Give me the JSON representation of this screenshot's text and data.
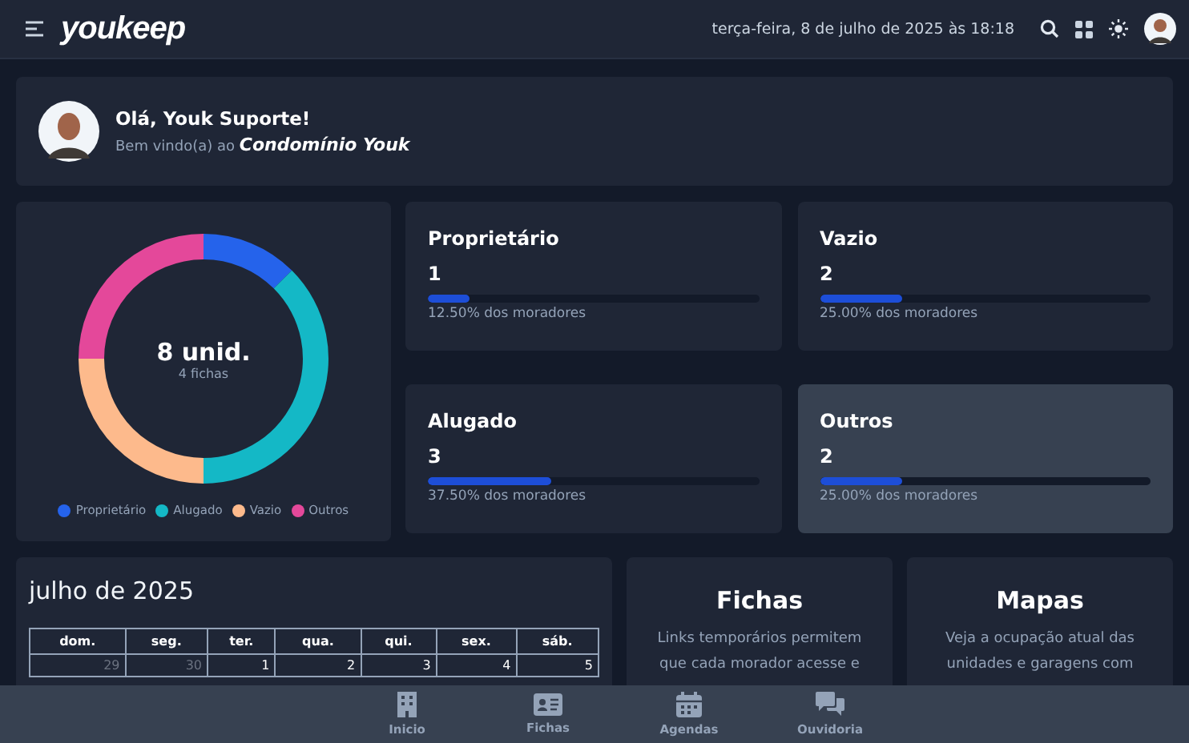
{
  "topbar": {
    "logo": "youkeep",
    "datetime": "terça-feira, 8 de julho de 2025 às 18:18"
  },
  "welcome": {
    "greeting": "Olá, Youk Suporte!",
    "subtitle": "Bem vindo(a) ao **Condomínio Youk**"
  },
  "summary": {
    "total": "8 unid.",
    "fichas": "4 fichas",
    "chart_data": {
      "type": "donut",
      "categories": [
        "Proprietário",
        "Alugado",
        "Vazio",
        "Outros"
      ],
      "values": [
        12.5,
        37.5,
        25,
        25
      ],
      "colors": [
        "#2563eb",
        "#14b8c6",
        "#fdba8c",
        "#e4489a"
      ]
    }
  },
  "stats": [
    {
      "label": "Proprietário",
      "count": "1",
      "level": 0.125,
      "percent": "12.50% dos moradores",
      "selected": false
    },
    {
      "label": "Vazio",
      "count": "2",
      "level": 0.25,
      "percent": "25.00% dos moradores",
      "selected": false
    },
    {
      "label": "Alugado",
      "count": "3",
      "level": 0.375,
      "percent": "37.50% dos moradores",
      "selected": false
    },
    {
      "label": "Outros",
      "count": "2",
      "level": 0.25,
      "percent": "25.00% dos moradores",
      "selected": true
    }
  ],
  "calendar": {
    "title": "julho de 2025",
    "weekdays": [
      "dom.",
      "seg.",
      "ter.",
      "qua.",
      "qui.",
      "sex.",
      "sáb."
    ],
    "days": [
      {
        "day": "29",
        "other_month": true
      },
      {
        "day": "30",
        "other_month": true
      },
      {
        "day": "1",
        "other_month": false
      },
      {
        "day": "2",
        "other_month": false
      },
      {
        "day": "3",
        "other_month": false
      },
      {
        "day": "4",
        "other_month": false
      },
      {
        "day": "5",
        "other_month": false
      }
    ]
  },
  "cards": [
    {
      "title": "Fichas",
      "text": "Links temporários permitem que cada morador acesse e"
    },
    {
      "title": "Mapas",
      "text": "Veja a ocupação atual das unidades e garagens com"
    }
  ],
  "bottom_nav": [
    {
      "label": "Inicio",
      "kind": "building"
    },
    {
      "label": "Fichas",
      "kind": "card"
    },
    {
      "label": "Agendas",
      "kind": "calendar"
    },
    {
      "label": "Ouvidoria",
      "kind": "chat"
    }
  ]
}
